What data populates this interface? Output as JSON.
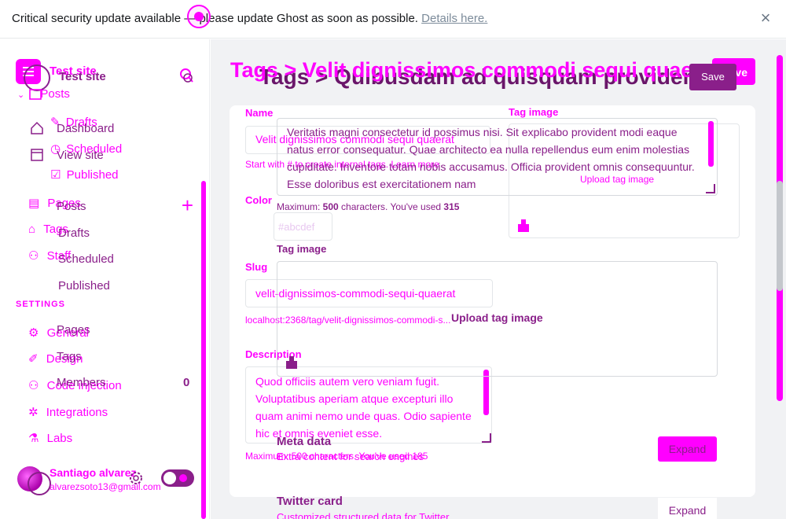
{
  "banner": {
    "text": "Critical security update available — please update Ghost as soon as possible.",
    "link": "Details here.",
    "close_icon": "close-icon"
  },
  "sidebar": {
    "site_title": "Test site",
    "nav_pink": [
      {
        "label": "Posts",
        "icon": "posts-icon"
      },
      {
        "label": "Drafts",
        "icon": "pencil-icon"
      },
      {
        "label": "Scheduled",
        "icon": "clock-icon"
      },
      {
        "label": "Published",
        "icon": "check-icon"
      },
      {
        "label": "Pages",
        "icon": "pages-icon"
      },
      {
        "label": "Tags",
        "icon": "tag-icon"
      },
      {
        "label": "Staff",
        "icon": "staff-icon"
      },
      {
        "label": "General",
        "icon": "general-icon"
      },
      {
        "label": "Design",
        "icon": "design-icon"
      },
      {
        "label": "Code injection",
        "icon": "code-icon"
      },
      {
        "label": "Integrations",
        "icon": "integrations-icon"
      },
      {
        "label": "Labs",
        "icon": "labs-icon"
      }
    ],
    "nav_dark": [
      {
        "label": "Dashboard"
      },
      {
        "label": "View site"
      },
      {
        "label": "Posts"
      },
      {
        "label": "Drafts"
      },
      {
        "label": "Scheduled"
      },
      {
        "label": "Published"
      },
      {
        "label": "Pages"
      },
      {
        "label": "Tags"
      },
      {
        "label": "Members"
      }
    ],
    "members_count": "0",
    "settings_label": "SETTINGS",
    "user": {
      "name": "Santiago alvarez",
      "email": "alvarezsoto13@gmail.com"
    }
  },
  "header": {
    "breadcrumb_pink": "Tags  >  Velit dignissimos commodi sequi quaerat",
    "breadcrumb_dark": "Tags > Quibusdam ad quisquam provident",
    "save_label_pink": "Save",
    "save_label_dark": "Save"
  },
  "form": {
    "name_label": "Name",
    "name_value": "Velit dignissimos commodi sequi quaerat",
    "name_hint": "Start with # to create internal tags. Learn more",
    "color_label": "Color",
    "color_value": "#abcdef",
    "slug_label": "Slug",
    "slug_value": "velit-dignissimos-commodi-sequi-quaerat",
    "slug_url": "localhost:2368/tag/velit-dignissimos-commodi-s...",
    "description_label": "Description",
    "description_value": "Quod officiis autem vero veniam fugit. Voluptatibus aperiam atque excepturi illo quam animi nemo unde quas. Odio sapiente hic et omnis eveniet esse.",
    "description_hint": "Maximum: 500 characters. You've used 185",
    "tag_image_label": "Tag image",
    "upload_label": "Upload tag image"
  },
  "overlay_form": {
    "description_value": "Veritatis magni consectetur id possimus nisi. Sit explicabo provident modi eaque natus error consequatur. Quae architecto ea nulla repellendus eum enim molestias cupiditate. Inventore totam nobis accusamus. Officia provident omnis consequuntur. Esse doloribus est exercitationem nam",
    "max_prefix": "Maximum: ",
    "max_value": "500",
    "max_middle": " characters. You've used ",
    "max_used": "315",
    "tag_image_label": "Tag image",
    "upload_label": "Upload tag image"
  },
  "sections": {
    "meta_title": "Meta data",
    "meta_sub": "Extra content for search engines",
    "twitter_title": "Twitter card",
    "twitter_sub": "Customized structured data for Twitter",
    "expand_label": "Expand"
  },
  "colors": {
    "accent": "#ff00ff",
    "accent_dark": "#8a1f8a",
    "background": "#f1f2f4"
  }
}
